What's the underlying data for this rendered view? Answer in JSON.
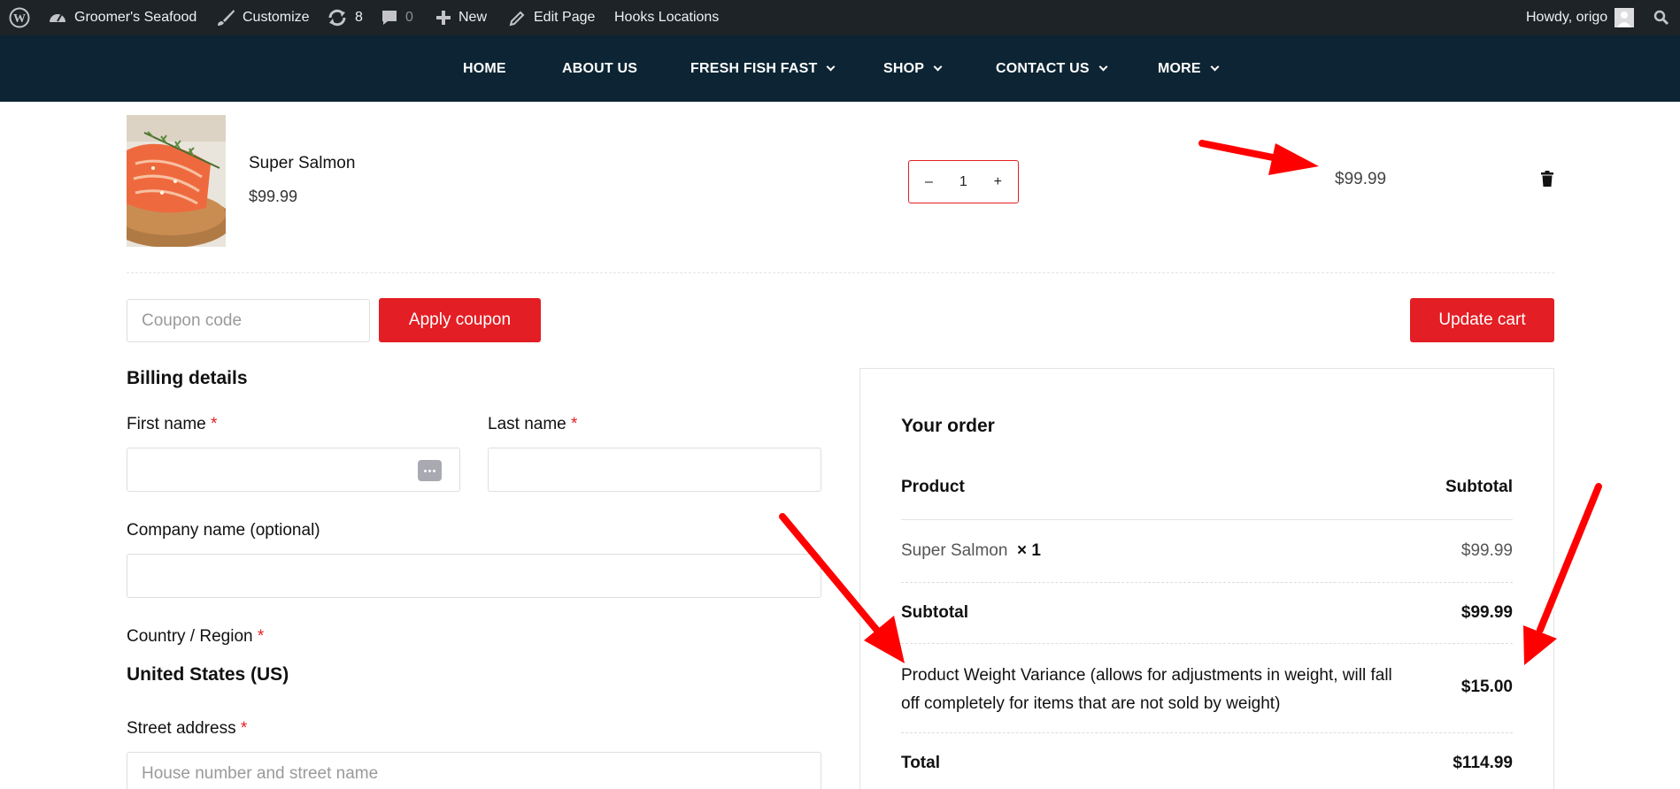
{
  "admin_bar": {
    "site_name": "Groomer's Seafood",
    "customize": "Customize",
    "updates_count": "8",
    "comments_count": "0",
    "new": "New",
    "edit_page": "Edit Page",
    "hooks": "Hooks Locations",
    "howdy": "Howdy, origo"
  },
  "nav": {
    "items": [
      "HOME",
      "ABOUT US",
      "FRESH FISH FAST",
      "SHOP",
      "CONTACT US",
      "MORE"
    ]
  },
  "cart": {
    "item_name": "Super Salmon",
    "item_price": "$99.99",
    "qty_minus": "–",
    "quantity": "1",
    "qty_plus": "+",
    "line_total": "$99.99"
  },
  "coupon": {
    "placeholder": "Coupon code",
    "apply_label": "Apply coupon",
    "update_label": "Update cart"
  },
  "billing": {
    "title": "Billing details",
    "first_name": "First name",
    "last_name": "Last name",
    "company": "Company name (optional)",
    "country": "Country / Region",
    "country_value": "United States (US)",
    "street": "Street address",
    "street_placeholder": "House number and street name",
    "required_mark": "*"
  },
  "order": {
    "title": "Your order",
    "col_product": "Product",
    "col_subtotal": "Subtotal",
    "line_name": "Super Salmon",
    "line_qty": "× 1",
    "line_value": "$99.99",
    "subtotal_label": "Subtotal",
    "subtotal_value": "$99.99",
    "variance_label": "Product Weight Variance (allows for adjustments in weight, will fall off completely for items that are not sold by weight)",
    "variance_value": "$15.00",
    "total_label": "Total",
    "total_value": "$114.99"
  },
  "colors": {
    "admin_bar": "#1d2327",
    "nav": "#0c2433",
    "accent_red": "#e31e24"
  }
}
